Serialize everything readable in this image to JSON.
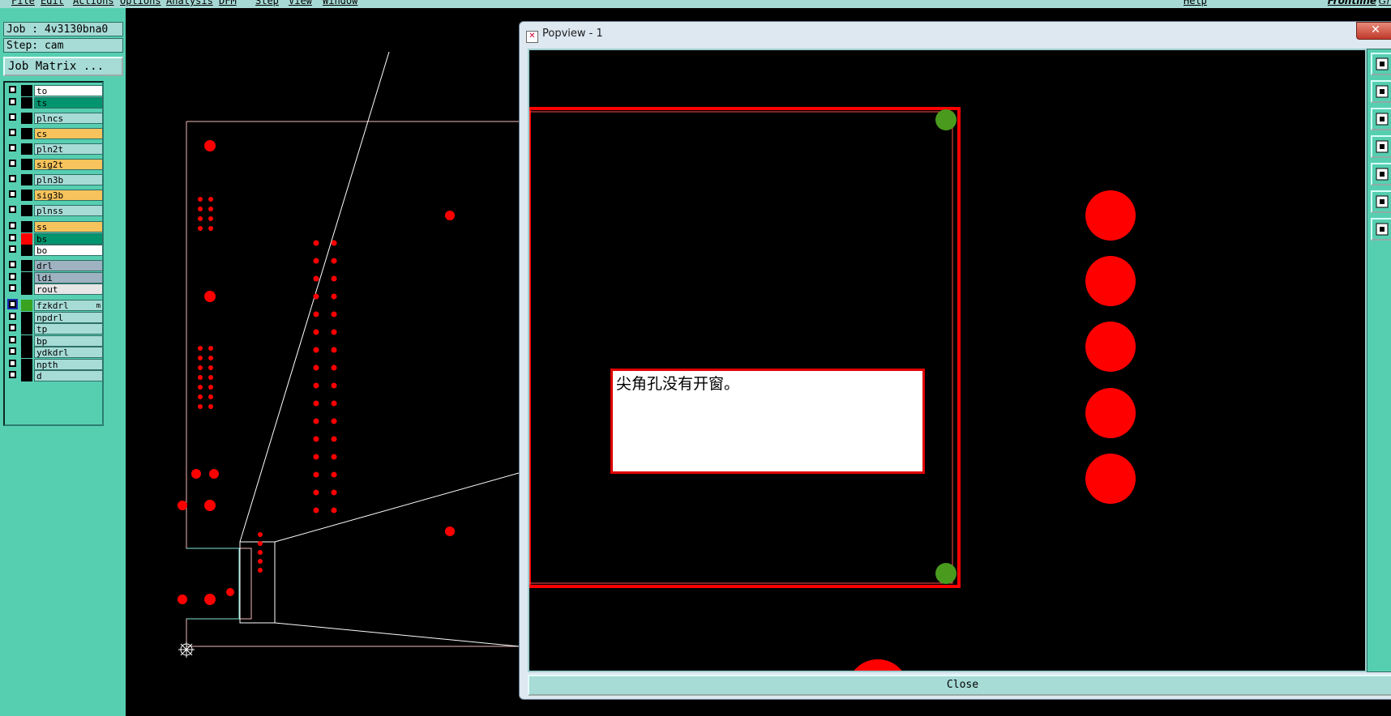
{
  "app": {
    "menu_items": [
      "File",
      "Edit",
      "Actions",
      "Options",
      "Analysis",
      "DFM",
      "Step",
      "View",
      "Window"
    ],
    "menu_right": "Help",
    "brand": "Frontline",
    "brand_sub": "Gr"
  },
  "left_panel": {
    "job_label": "Job : 4v3130bna0",
    "step_label": "Step: cam",
    "job_matrix_button": "Job Matrix ...",
    "layers": [
      {
        "name": "to",
        "color": "#ffffff",
        "swatch": "#000000",
        "checked": false
      },
      {
        "name": "ts",
        "color": "#00956e",
        "swatch": "#000000",
        "checked": false
      },
      {
        "name": "plncs",
        "color": "#a6dbd6",
        "swatch": "#000000",
        "checked": false
      },
      {
        "name": "cs",
        "color": "#f7c35c",
        "swatch": "#000000",
        "checked": false
      },
      {
        "name": "pln2t",
        "color": "#a6dbd6",
        "swatch": "#000000",
        "checked": false
      },
      {
        "name": "sig2t",
        "color": "#f7c35c",
        "swatch": "#000000",
        "checked": false
      },
      {
        "name": "pln3b",
        "color": "#a6dbd6",
        "swatch": "#000000",
        "checked": false
      },
      {
        "name": "sig3b",
        "color": "#f7c35c",
        "swatch": "#000000",
        "checked": false
      },
      {
        "name": "plnss",
        "color": "#a6dbd6",
        "swatch": "#000000",
        "checked": false
      },
      {
        "name": "ss",
        "color": "#f7c35c",
        "swatch": "#000000",
        "checked": false
      },
      {
        "name": "bs",
        "color": "#00956e",
        "swatch": "#ff0000",
        "checked": false
      },
      {
        "name": "bo",
        "color": "#ffffff",
        "swatch": "#000000",
        "checked": false
      },
      {
        "name": "drl",
        "color": "#9eb2c1",
        "swatch": "#000000",
        "checked": false
      },
      {
        "name": "ldi",
        "color": "#9eb2c1",
        "swatch": "#000000",
        "checked": false
      },
      {
        "name": "rout",
        "color": "#e6e6e6",
        "swatch": "#000000",
        "checked": false
      },
      {
        "name": "fzkdrl",
        "color": "#a6dbd6",
        "swatch": "#39a321",
        "checked": true,
        "mark": "m"
      },
      {
        "name": "npdrl",
        "color": "#a6dbd6",
        "swatch": "#000000",
        "checked": false
      },
      {
        "name": "tp",
        "color": "#a6dbd6",
        "swatch": "#000000",
        "checked": false
      },
      {
        "name": "bp",
        "color": "#a6dbd6",
        "swatch": "#000000",
        "checked": false
      },
      {
        "name": "ydkdrl",
        "color": "#a6dbd6",
        "swatch": "#000000",
        "checked": false
      },
      {
        "name": "npth",
        "color": "#a6dbd6",
        "swatch": "#000000",
        "checked": false
      },
      {
        "name": "d",
        "color": "#a6dbd6",
        "swatch": "#000000",
        "checked": false
      }
    ]
  },
  "popview": {
    "title": "Popview - 1",
    "close_x": "✕",
    "message": "尖角孔没有开窗。",
    "close_button": "Close",
    "tools": [
      "zoom-window-icon",
      "zoom-in-icon",
      "zoom-out-icon",
      "pan-left-icon",
      "pan-right-icon",
      "fit-all-icon",
      "fit-view-icon"
    ]
  },
  "colors": {
    "pad": "#ff0000",
    "outline": "#ff5555",
    "highlight_hole": "#4a9a1e",
    "profile": "#cfe3ef"
  }
}
